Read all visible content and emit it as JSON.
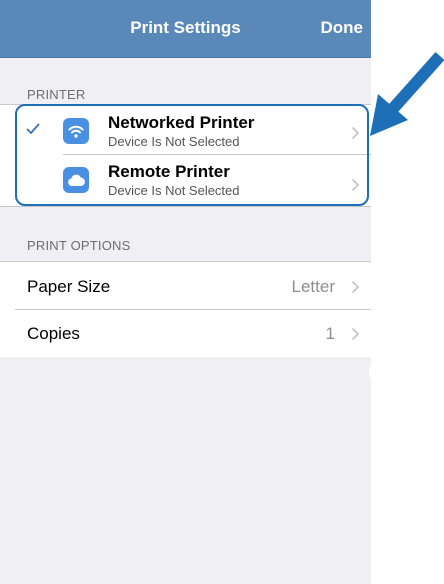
{
  "navbar": {
    "title": "Print Settings",
    "done_label": "Done"
  },
  "printer_section": {
    "header": "PRINTER",
    "items": [
      {
        "title": "Networked Printer",
        "subtitle": "Device Is Not Selected",
        "icon": "wifi-icon",
        "selected": true
      },
      {
        "title": "Remote Printer",
        "subtitle": "Device Is Not Selected",
        "icon": "cloud-icon",
        "selected": false
      }
    ]
  },
  "options_section": {
    "header": "PRINT OPTIONS",
    "items": [
      {
        "label": "Paper Size",
        "value": "Letter"
      },
      {
        "label": "Copies",
        "value": "1"
      }
    ]
  },
  "colors": {
    "nav_bar": "#5a88b8",
    "app_icon": "#4a90e2",
    "checkmark": "#3b6fb6",
    "annotation": "#1d6fb8"
  }
}
